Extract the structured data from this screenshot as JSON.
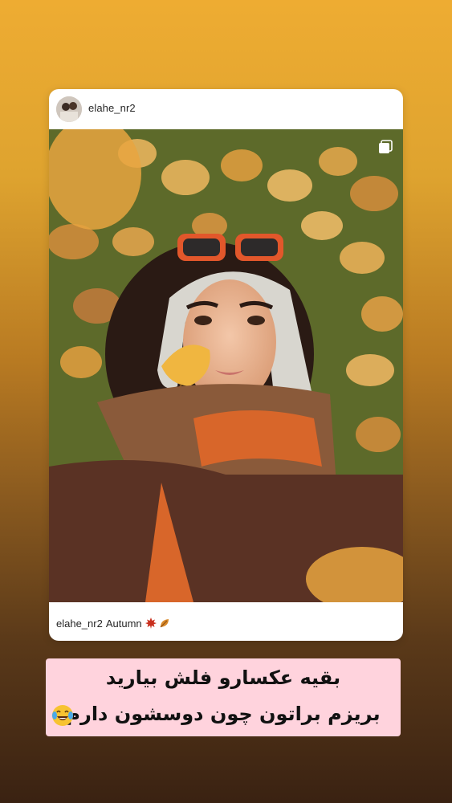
{
  "post": {
    "username": "elahe_nr2",
    "caption_username": "elahe_nr2",
    "caption_text": "Autumn",
    "caption_emojis": [
      "maple-leaf",
      "fallen-leaf"
    ]
  },
  "overlay_text": {
    "line1": "بقیه عکسارو فلش بیارید",
    "line2": "بریزم براتون چون دوسشون دارم",
    "emoji": "face-with-tears-of-joy"
  },
  "colors": {
    "background_top": "#eeac32",
    "background_bottom": "#3a2212",
    "text_box": "#ffd3dd",
    "card": "#ffffff"
  }
}
